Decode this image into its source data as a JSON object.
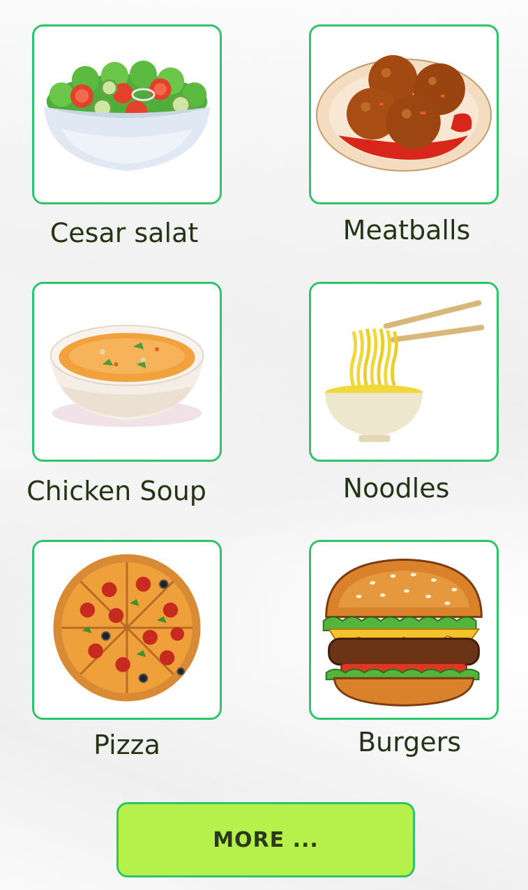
{
  "foods": [
    {
      "label": "Cesar salat",
      "icon": "salad-bowl-icon"
    },
    {
      "label": "Meatballs",
      "icon": "meatballs-plate-icon"
    },
    {
      "label": "Chicken Soup",
      "icon": "soup-bowl-icon"
    },
    {
      "label": "Noodles",
      "icon": "noodles-chopsticks-icon"
    },
    {
      "label": "Pizza",
      "icon": "pizza-icon"
    },
    {
      "label": "Burgers",
      "icon": "burger-icon"
    }
  ],
  "more_button": {
    "label": "MORE ..."
  },
  "colors": {
    "card_border": "#2fc46a",
    "button_fill": "#b6f04a",
    "label_text": "#243414"
  }
}
